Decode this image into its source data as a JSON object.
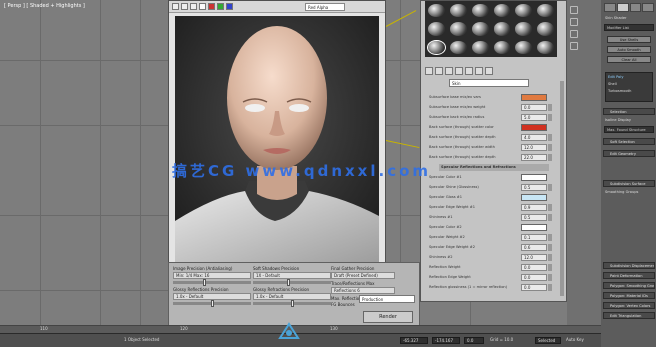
{
  "viewport": {
    "label": "[ Persp ] [ Shaded + Highlights ]",
    "ruler_numbers": [
      "110",
      "120",
      "130"
    ]
  },
  "render_window": {
    "channel_dropdown": "Red Alpha"
  },
  "render_setup": {
    "columns": [
      {
        "label1": "Image Precision (Antialiasing)",
        "field1": "Min: 1/4   Max: 16",
        "label2": "Glossy Reflections Precision",
        "field2": "1.0x - Default"
      },
      {
        "label1": "Soft Shadows Precision",
        "field1": "1X - Default",
        "label2": "Glossy Refractions Precision",
        "field2": "1.0x - Default"
      },
      {
        "label1": "Final Gather Precision",
        "field1": "Draft (Preset Defined)",
        "label2": "Trace/Reflections Max",
        "field2": "Reflections  6"
      }
    ],
    "extra_labels": [
      "Max. Reflections",
      "FG Bounces"
    ],
    "preset_value": "Production",
    "render_button": "Render",
    "production_label": "Production"
  },
  "material_editor": {
    "material_name": "Skin",
    "rows": [
      {
        "label": "Subsurface base mix/ex vars",
        "swatch": "#e07a40"
      },
      {
        "label": "Subsurface base mix/ex weight",
        "value": "0.0"
      },
      {
        "label": "Subsurface back mix/ex radius",
        "value": "5.0"
      },
      {
        "label": "Back surface (through) scatter color",
        "swatch": "#d03020"
      },
      {
        "label": "Back surface (through) scatter depth",
        "value": "4.0"
      },
      {
        "label": "Back surface (through) scatter width",
        "value": "12.0"
      },
      {
        "label": "Back surface (through) scatter depth",
        "value": "22.0"
      },
      {
        "group": "Specular Reflections and Refractions"
      },
      {
        "label": "Specular Color #1",
        "swatch": "#ffffff"
      },
      {
        "label": "Specular Shine (Glossiness)",
        "value": "0.5"
      },
      {
        "label": "Specular Gloss #1",
        "swatch": "#c8e6f5"
      },
      {
        "label": "Specular Edge Weight #1",
        "value": "0.9"
      },
      {
        "label": "Shininess #1",
        "value": "0.5"
      },
      {
        "label": "Specular Color #2",
        "swatch": "#ffffff"
      },
      {
        "label": "Specular Weight #2",
        "value": "0.1"
      },
      {
        "label": "Specular Edge Weight #2",
        "value": "0.6"
      },
      {
        "label": "Shininess #2",
        "value": "12.0"
      },
      {
        "label": "Reflection Weight",
        "value": "0.0"
      },
      {
        "label": "Reflection Edge Weight",
        "value": "0.0"
      },
      {
        "label": "Reflection glossiness (1 = mirror reflection)",
        "value": "0.0"
      }
    ]
  },
  "command_panel": {
    "lines": [
      "Skin Shader",
      "Modifier List",
      "Edit Poly",
      "Shell",
      "Turbosmooth",
      "Isoline Display",
      "Max. Found Structure",
      "Smoothing Groups"
    ],
    "buttons": [
      "Use Shells",
      "Auto Smooth",
      "Clear All"
    ],
    "rollouts": [
      "Edit Geometry",
      "Subdivision Surface",
      "Subdivision Displacement",
      "Paint Deformation",
      "Polygon: Smoothing Groups",
      "Polygon: Material IDs",
      "Polygon: Vertex Colors",
      "Edit Triangulation"
    ],
    "fields": [
      "Selection",
      "Soft Selection"
    ]
  },
  "watermark": {
    "text": "搞艺CG  www.qdnxxl.com"
  },
  "status": {
    "left_text": "1 Object Selected",
    "x_value": "-65.327",
    "y_value": "-174.167",
    "z_value": "0.0",
    "grid_label": "Grid = 10.0",
    "auto_key": "Auto Key",
    "selected_dropdown": "Selected",
    "key_filters": "Set Key",
    "frame": "0"
  }
}
